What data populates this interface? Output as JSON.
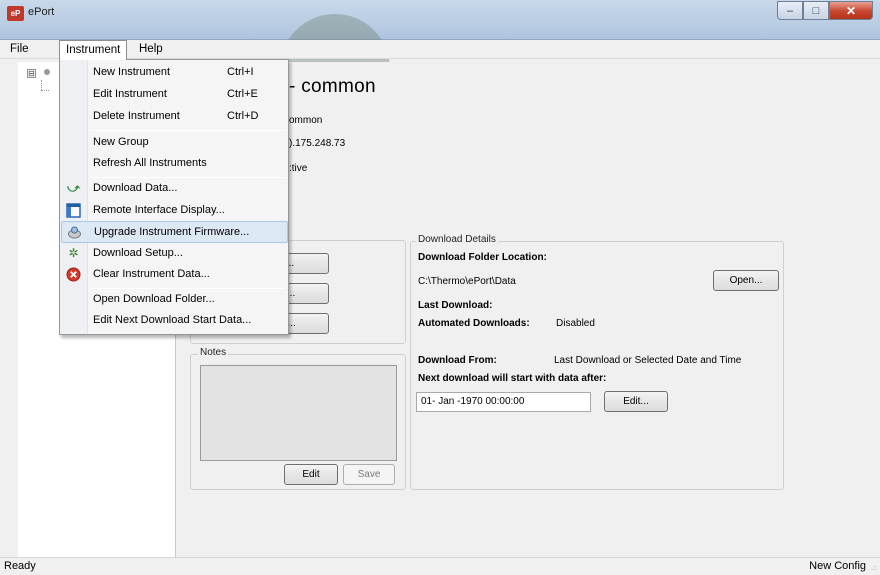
{
  "window": {
    "title": "ePort",
    "app_icon_text": "eP"
  },
  "window_controls": {
    "minimize": "–",
    "maximize": "□",
    "close": "✕"
  },
  "menubar": {
    "file": "File",
    "instrument": "Instrument",
    "help": "Help"
  },
  "tree": {
    "expander": "⊟"
  },
  "instrument_menu": {
    "new_instrument": {
      "label": "New Instrument",
      "shortcut": "Ctrl+I"
    },
    "edit_instrument": {
      "label": "Edit Instrument",
      "shortcut": "Ctrl+E"
    },
    "delete_instrument": {
      "label": "Delete Instrument",
      "shortcut": "Ctrl+D"
    },
    "new_group": {
      "label": "New Group"
    },
    "refresh_all": {
      "label": "Refresh All Instruments"
    },
    "download_data": {
      "label": "Download Data...",
      "icon": "download-arrow-icon"
    },
    "remote_interface": {
      "label": "Remote Interface Display...",
      "icon": "display-icon"
    },
    "upgrade_firmware": {
      "label": "Upgrade Instrument Firmware...",
      "icon": "firmware-disc-icon"
    },
    "download_setup": {
      "label": "Download Setup...",
      "icon": "setup-tool-icon"
    },
    "clear_data": {
      "label": "Clear Instrument Data...",
      "icon": "clear-x-icon"
    },
    "open_folder": {
      "label": "Open Download Folder..."
    },
    "edit_next_start": {
      "label": "Edit Next Download Start Data..."
    }
  },
  "instrument_panel": {
    "heading": "- common",
    "line1": "ommon",
    "line2": ").175.248.73",
    "line3": ":tive",
    "buttons": {
      "data": "ata...",
      "interface": "face...",
      "setup": "etup..."
    }
  },
  "notes": {
    "legend": "Notes",
    "edit": "Edit",
    "save": "Save"
  },
  "download_details": {
    "legend": "Download Details",
    "folder_label": "Download Folder Location:",
    "folder_path": "C:\\Thermo\\ePort\\Data",
    "open_button": "Open...",
    "last_download_label": "Last Download:",
    "automated_label": "Automated Downloads:",
    "automated_value": "Disabled",
    "download_from_label": "Download From:",
    "download_from_value": "Last Download or Selected Date and Time",
    "next_download_label": "Next download will start with data after:",
    "next_date": "01- Jan -1970 00:00:00",
    "edit_button": "Edit..."
  },
  "status": {
    "left": "Ready",
    "right": "New Config",
    "grip": ".::"
  },
  "colors": {
    "menu_hover": "#dde8f5",
    "close_button": "#c8452f",
    "titlebar": "#b9cde3"
  }
}
